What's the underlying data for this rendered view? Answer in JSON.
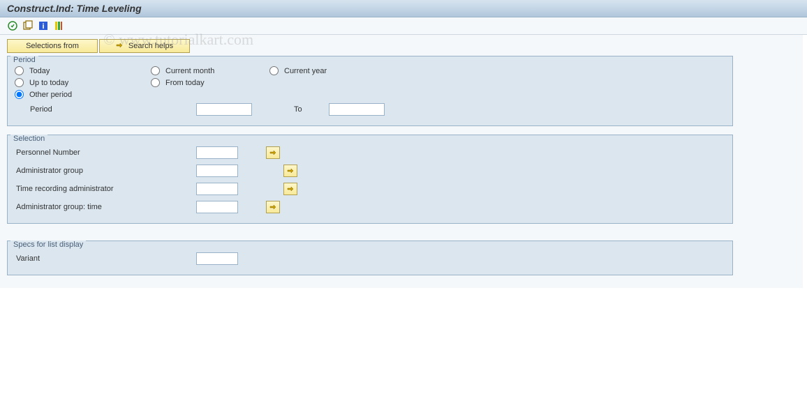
{
  "title": "Construct.Ind: Time Leveling",
  "watermark": "© www.tutorialkart.com",
  "toolbar": {
    "execute": "execute",
    "variant": "variant",
    "info": "info",
    "exit": "exit"
  },
  "buttons": {
    "selections_from": "Selections from",
    "search_helps": "Search helps"
  },
  "period": {
    "legend": "Period",
    "today": "Today",
    "current_month": "Current month",
    "current_year": "Current year",
    "up_to_today": "Up to today",
    "from_today": "From today",
    "other_period": "Other period",
    "period_label": "Period",
    "to_label": "To",
    "period_from": "",
    "period_to": ""
  },
  "selection": {
    "legend": "Selection",
    "personnel_number": "Personnel Number",
    "admin_group": "Administrator group",
    "time_rec_admin": "Time recording administrator",
    "admin_group_time": "Administrator group: time",
    "personnel_number_val": "",
    "admin_group_val": "",
    "time_rec_admin_val": "",
    "admin_group_time_val": ""
  },
  "specs": {
    "legend": "Specs for list display",
    "variant": "Variant",
    "variant_val": ""
  }
}
